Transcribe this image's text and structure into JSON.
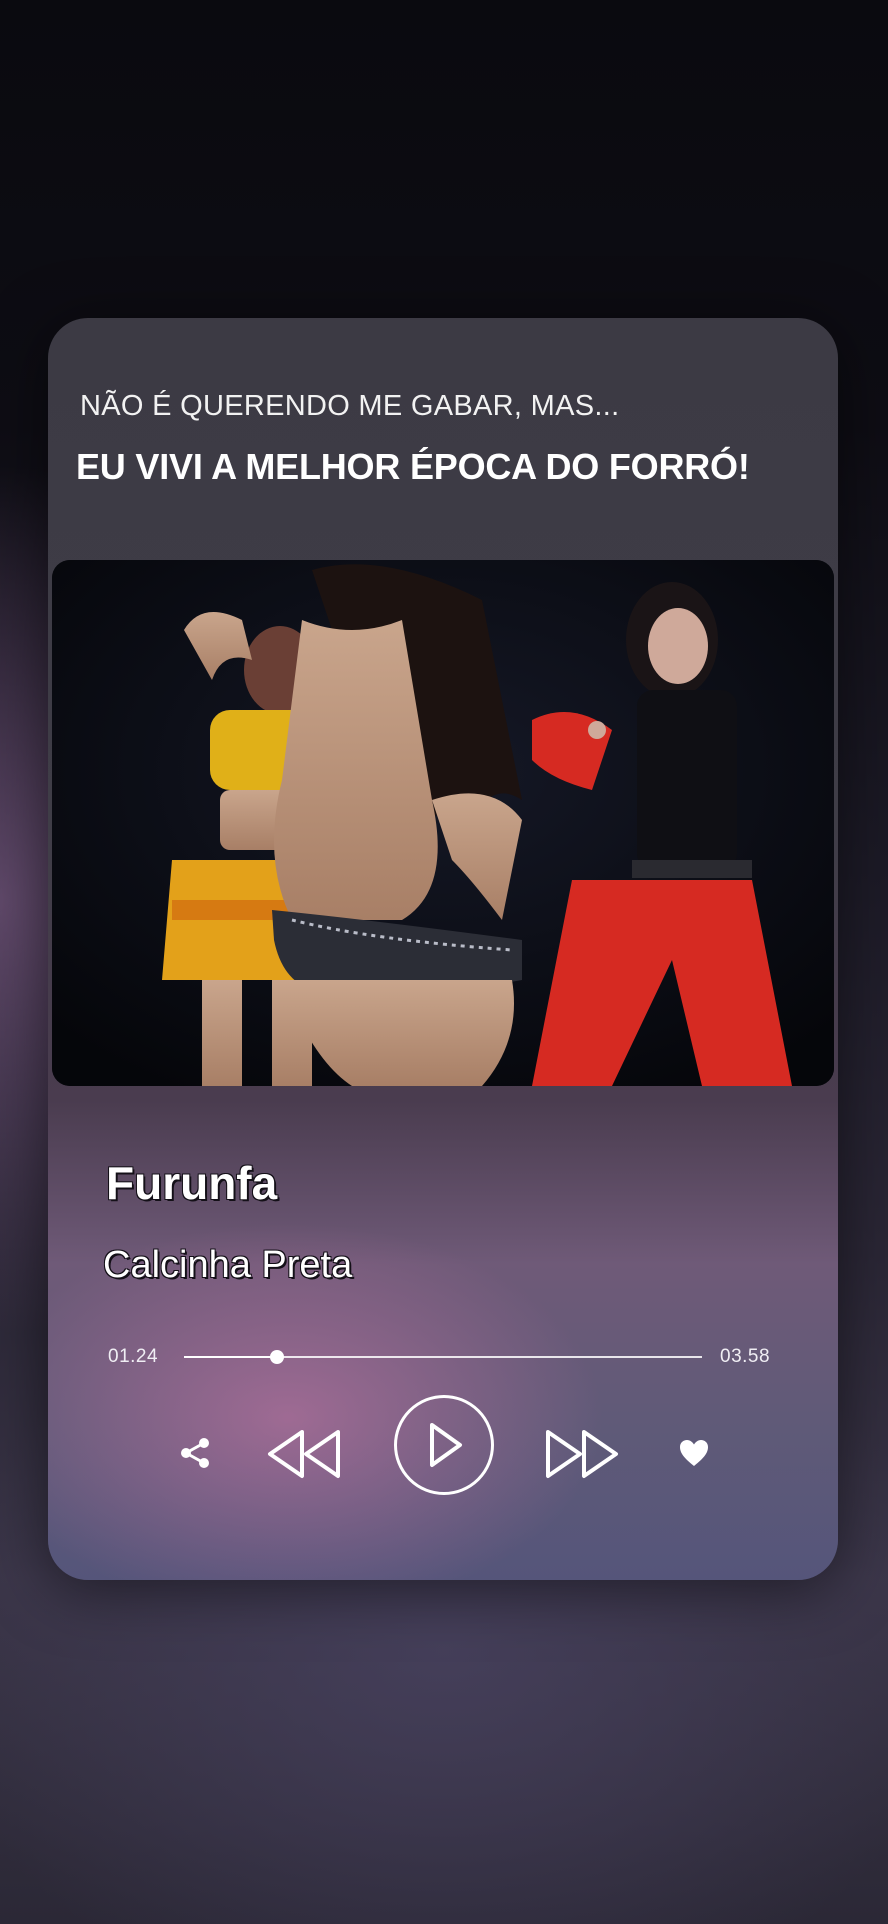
{
  "header": {
    "line1": "NÃO É QUERENDO ME GABAR, MAS...",
    "line2": "EU VIVI A MELHOR ÉPOCA DO FORRÓ!"
  },
  "video": {
    "description_icon": "concert-video-frame"
  },
  "track": {
    "title": "Furunfa",
    "artist": "Calcinha Preta"
  },
  "player": {
    "elapsed": "01.24",
    "total": "03.58",
    "progress_fraction": 0.18
  },
  "controls": {
    "share_icon": "share-icon",
    "prev_icon": "rewind-icon",
    "play_icon": "play-icon",
    "next_icon": "fast-forward-icon",
    "like_icon": "heart-icon"
  },
  "colors": {
    "accent": "#ffffff",
    "card_top": "#3c3a44",
    "card_glow": "#d278aa"
  }
}
